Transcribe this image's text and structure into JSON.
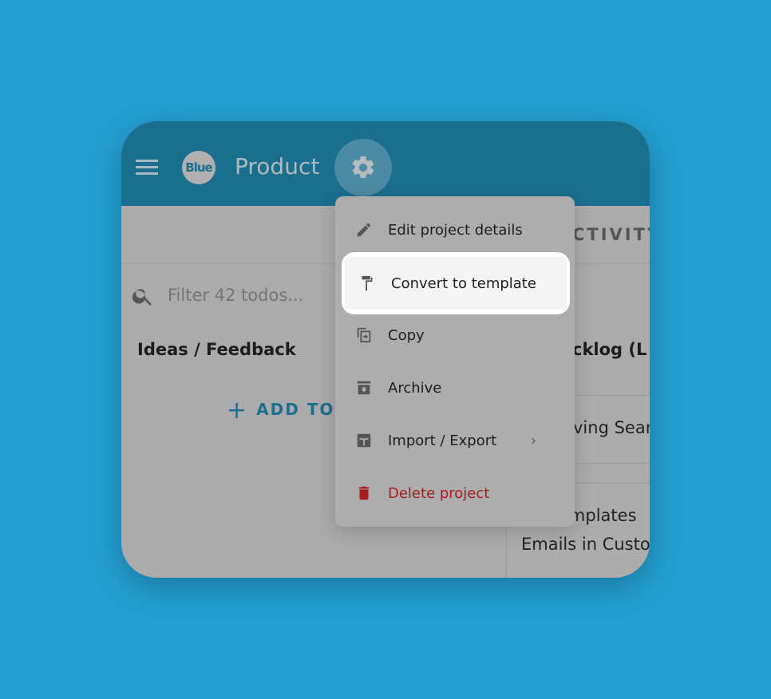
{
  "colors": {
    "background": "#249fd2",
    "header": "#1a6e8e",
    "accent": "#1b6f90",
    "danger": "#a71c1c"
  },
  "header": {
    "logo": "Blue",
    "title": "Product",
    "settings_icon": "gear-icon",
    "menu_icon": "hamburger-icon"
  },
  "tabs": {
    "activity": "CTIVITY"
  },
  "search": {
    "placeholder": "Filter 42 todos..."
  },
  "columns": [
    {
      "title": "Ideas / Feedback",
      "add_label": "ADD TOD"
    },
    {
      "title": "cklog (L",
      "cards": [
        "ving Sear",
        "emplates",
        "Emails in Custo"
      ]
    }
  ],
  "menu": {
    "items": [
      {
        "label": "Edit project details",
        "icon": "pencil-icon"
      },
      {
        "label": "Convert to template",
        "icon": "paint-roller-icon",
        "highlighted": true
      },
      {
        "label": "Copy",
        "icon": "copy-icon"
      },
      {
        "label": "Archive",
        "icon": "archive-icon"
      },
      {
        "label": "Import / Export",
        "icon": "import-export-icon",
        "submenu": true
      },
      {
        "label": "Delete project",
        "icon": "trash-icon",
        "danger": true
      }
    ]
  }
}
